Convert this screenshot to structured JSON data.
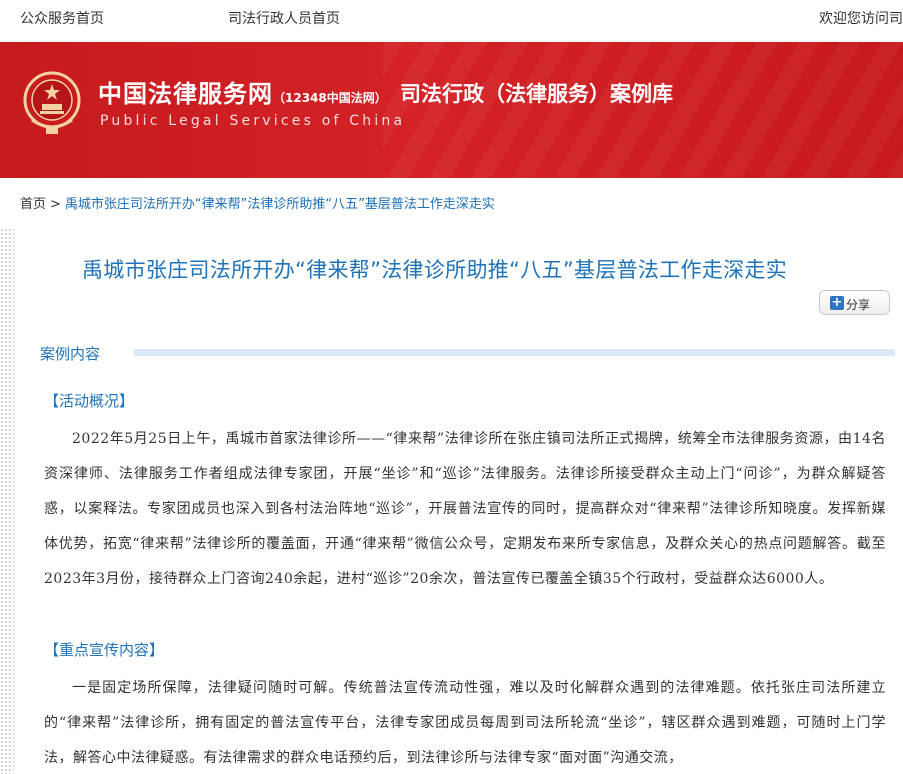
{
  "topbar": {
    "public_home": "公众服务首页",
    "staff_home": "司法行政人员首页",
    "welcome": "欢迎您访问司"
  },
  "header": {
    "site_name": "中国法律服务网",
    "site_sub": "（12348中国法网）",
    "site_en": "Public Legal Services of China",
    "section_name": "司法行政（法律服务）案例库",
    "brand_color": "#d42226"
  },
  "breadcrumb": {
    "home": "首页",
    "separator": ">",
    "current": "禹城市张庄司法所开办“律来帮”法律诊所助推“八五”基层普法工作走深走实"
  },
  "article": {
    "title": "禹城市张庄司法所开办“律来帮”法律诊所助推“八五”基层普法工作走深走实",
    "share_label": "分享",
    "section_label": "案例内容",
    "subhead1": "【活动概况】",
    "para1": "2022年5月25日上午，禹城市首家法律诊所——“律来帮”法律诊所在张庄镇司法所正式揭牌，统筹全市法律服务资源，由14名资深律师、法律服务工作者组成法律专家团，开展“坐诊”和“巡诊”法律服务。法律诊所接受群众主动上门“问诊”，为群众解疑答惑，以案释法。专家团成员也深入到各村法治阵地“巡诊”，开展普法宣传的同时，提高群众对“律来帮”法律诊所知晓度。发挥新媒体优势，拓宽“律来帮”法律诊所的覆盖面，开通“律来帮”微信公众号，定期发布来所专家信息，及群众关心的热点问题解答。截至2023年3月份，接待群众上门咨询240余起，进村“巡诊”20余次，普法宣传已覆盖全镇35个行政村，受益群众达6000人。",
    "subhead2": "【重点宣传内容】",
    "para2": "一是固定场所保障，法律疑问随时可解。传统普法宣传流动性强，难以及时化解群众遇到的法律难题。依托张庄司法所建立的“律来帮”法律诊所，拥有固定的普法宣传平台，法律专家团成员每周到司法所轮流“坐诊”，辖区群众遇到难题，可随时上门学法，解答心中法律疑惑。有法律需求的群众电话预约后，到法律诊所与法律专家“面对面”沟通交流，"
  },
  "colors": {
    "link_blue": "#1f73b8",
    "section_bar": "#dbe9f6"
  }
}
